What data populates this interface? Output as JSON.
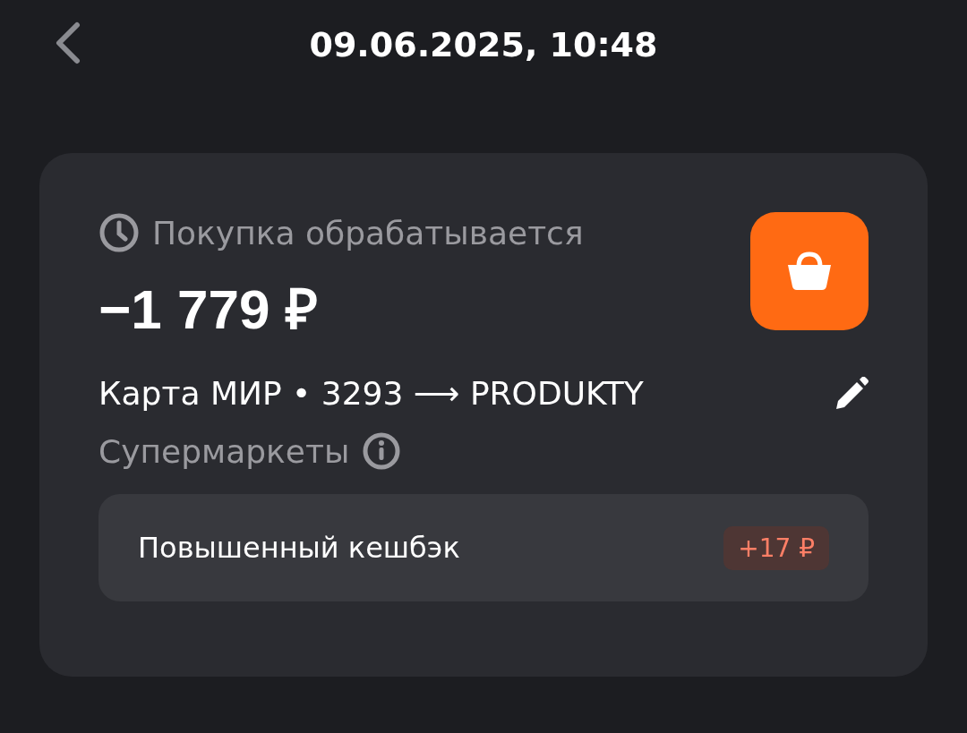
{
  "header": {
    "title": "09.06.2025, 10:48"
  },
  "operation": {
    "status": "Покупка обрабатывается",
    "amount": "−1 779 ₽",
    "route": "Карта МИР • 3293 ⟶ PRODUKTY",
    "category": "Супермаркеты"
  },
  "cashback": {
    "label": "Повышенный кешбэк",
    "value": "+17 ₽"
  }
}
